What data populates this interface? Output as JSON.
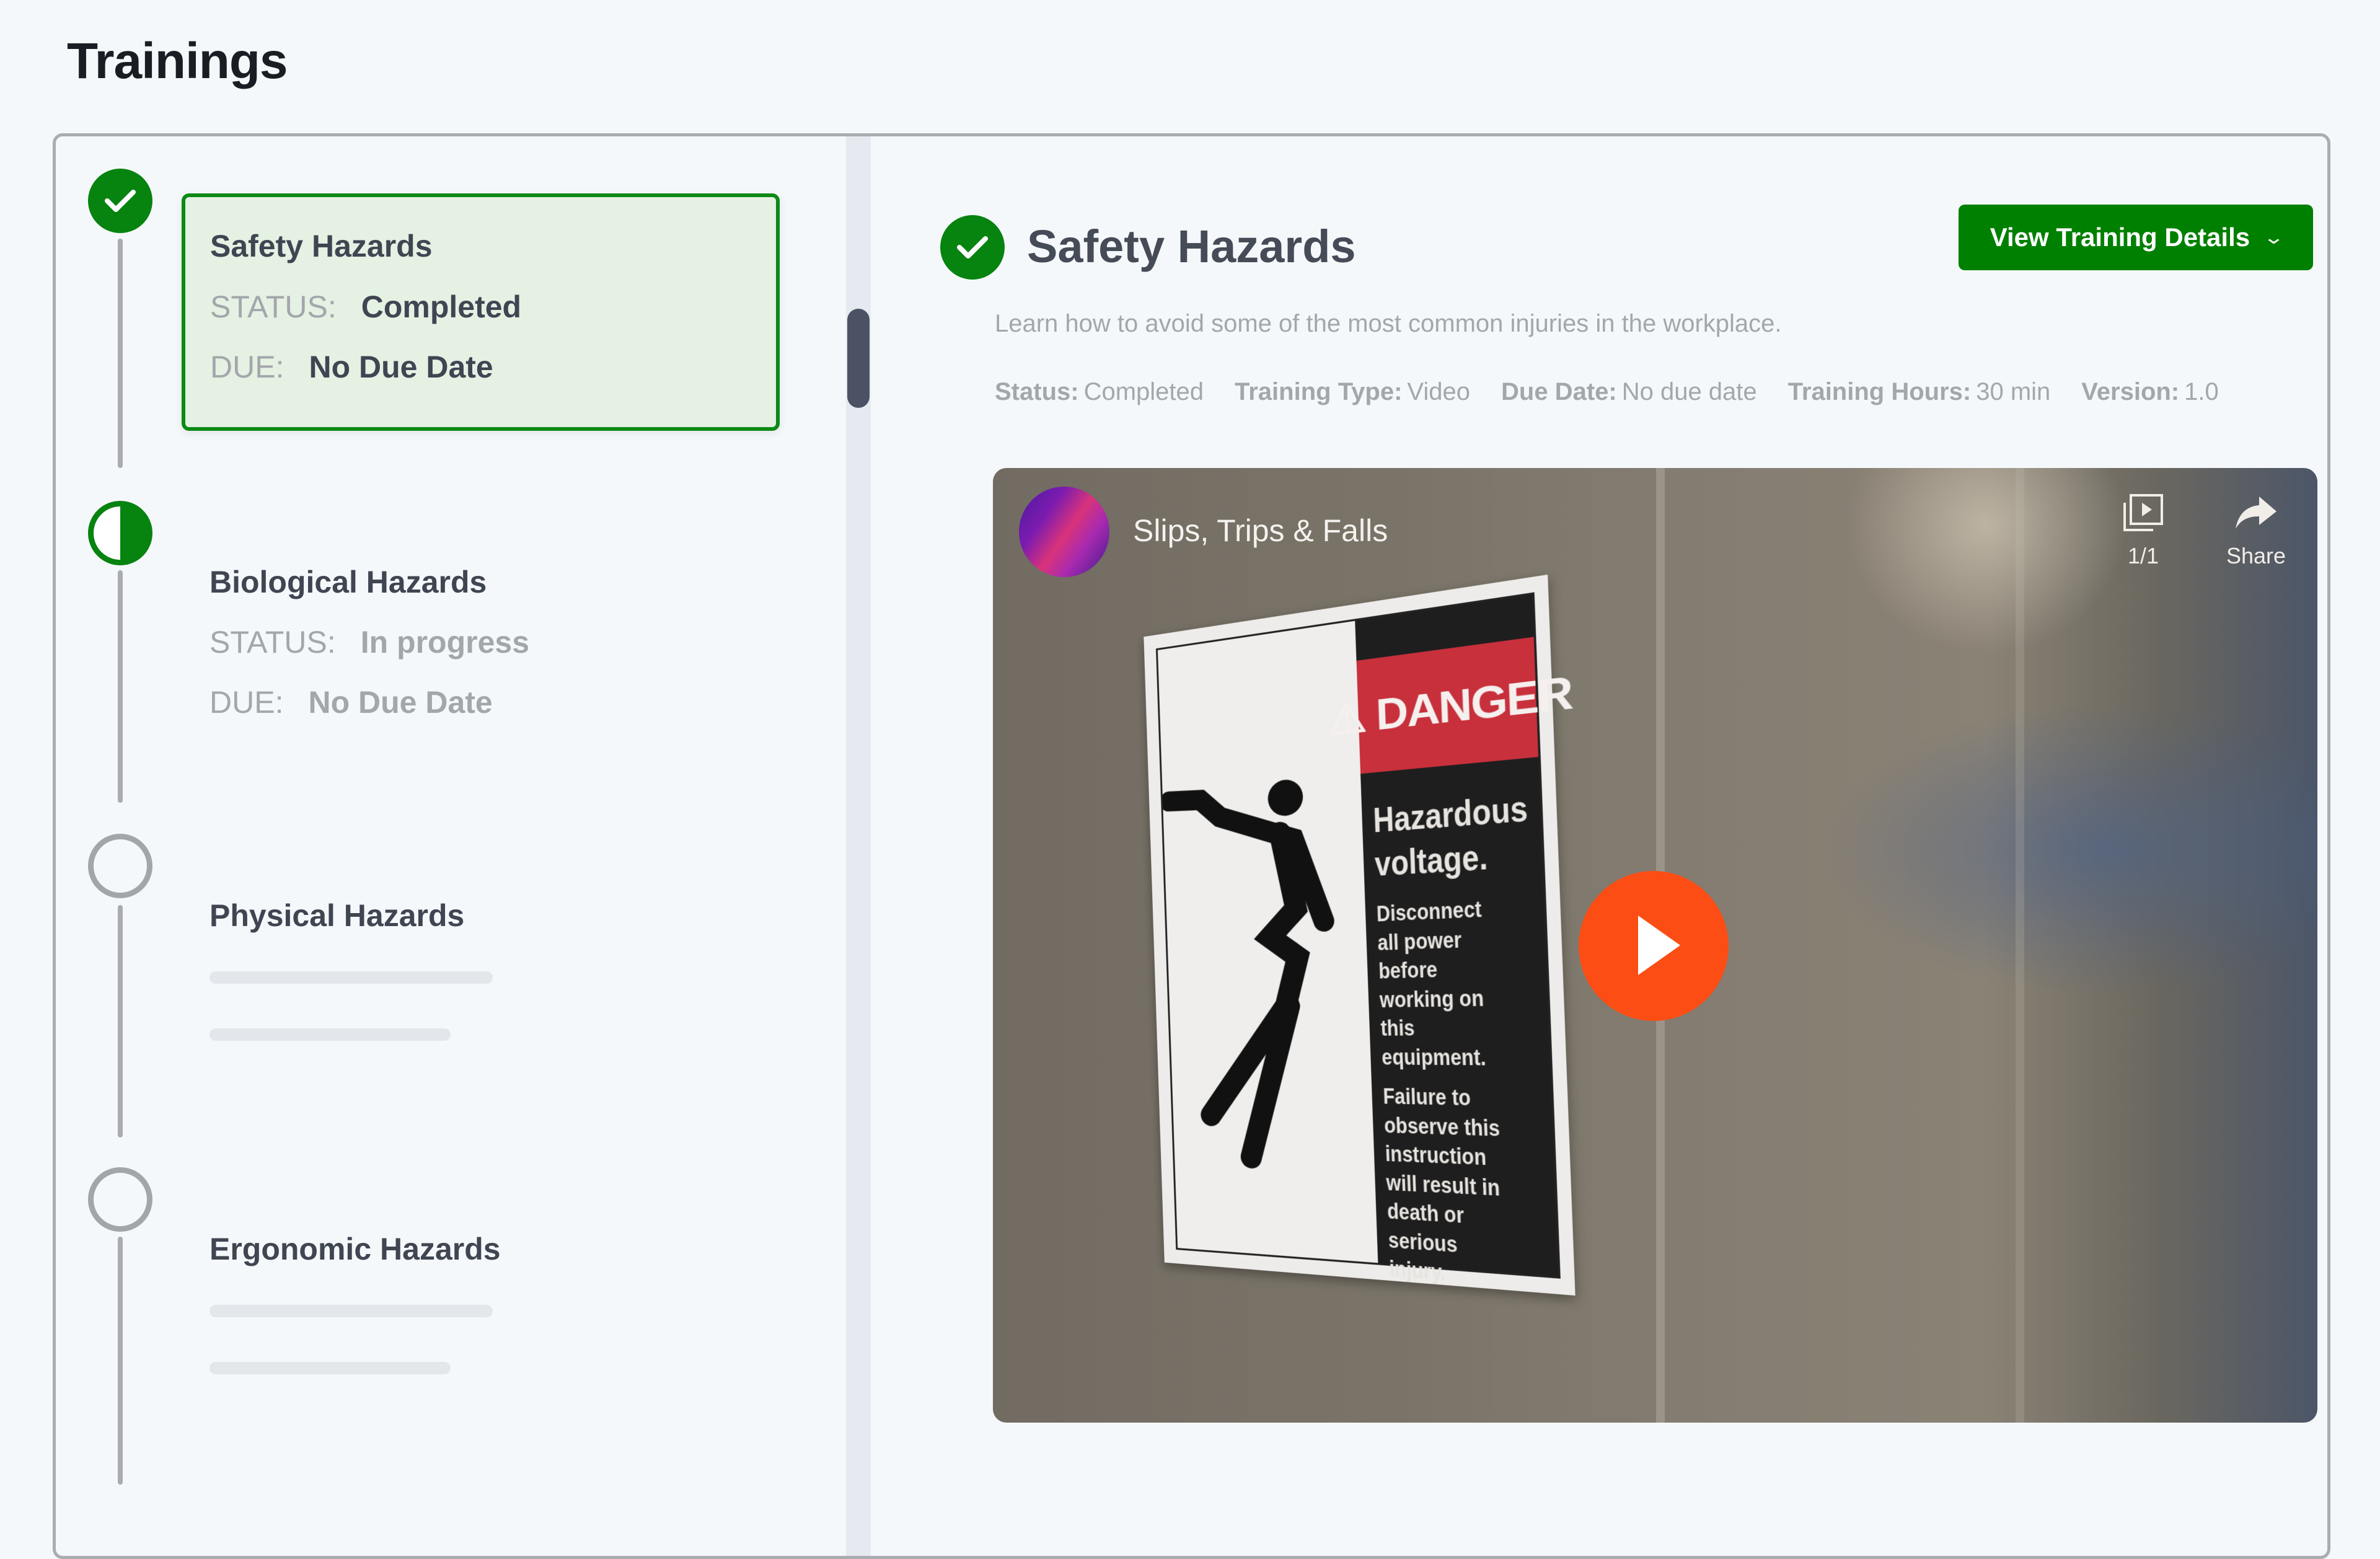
{
  "page": {
    "title": "Trainings"
  },
  "trainings": [
    {
      "title": "Safety Hazards",
      "state": "completed",
      "status_label": "STATUS:",
      "status_value": "Completed",
      "due_label": "DUE:",
      "due_value": "No Due Date",
      "selected": true
    },
    {
      "title": "Biological Hazards",
      "state": "in-progress",
      "status_label": "STATUS:",
      "status_value": "In progress",
      "due_label": "DUE:",
      "due_value": "No Due Date",
      "selected": false
    },
    {
      "title": "Physical Hazards",
      "state": "not-started",
      "loading": true
    },
    {
      "title": "Ergonomic Hazards",
      "state": "not-started",
      "loading": true
    }
  ],
  "detail": {
    "title": "Safety Hazards",
    "status_icon": "check-circle-icon",
    "button_label": "View Training Details",
    "description": "Learn how to avoid some of the most common injuries in the workplace.",
    "meta": [
      {
        "key": "Status:",
        "value": "Completed"
      },
      {
        "key": "Training Type:",
        "value": "Video"
      },
      {
        "key": "Due Date:",
        "value": "No due date"
      },
      {
        "key": "Training Hours:",
        "value": "30 min"
      },
      {
        "key": "Version:",
        "value": "1.0"
      }
    ],
    "video": {
      "title": "Slips, Trips & Falls",
      "playlist_count": "1/1",
      "share_label": "Share",
      "sign": {
        "header": "DANGER",
        "headline": "Hazardous voltage.",
        "line1": "Disconnect all power before working on this equipment.",
        "line2": "Failure to observe this instruction will result in death or serious injury."
      }
    }
  },
  "colors": {
    "accent_green": "#008000",
    "card_bg": "#e4f1e3",
    "play_button": "#fc4d14",
    "muted_text": "#a3a6ab",
    "primary_text": "#3f4652"
  }
}
